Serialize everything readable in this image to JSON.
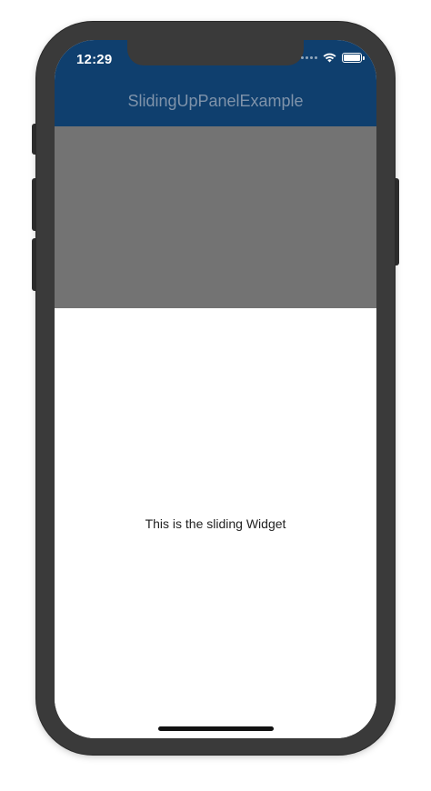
{
  "status_bar": {
    "time": "12:29",
    "icons": [
      "signal-dots-icon",
      "wifi-icon",
      "battery-icon"
    ]
  },
  "app_bar": {
    "title": "SlidingUpPanelExample",
    "background_color": "#0f3f6e",
    "title_color": "#7f93aa"
  },
  "body": {
    "backdrop_color": "#737373"
  },
  "panel": {
    "text": "This is the sliding Widget"
  }
}
